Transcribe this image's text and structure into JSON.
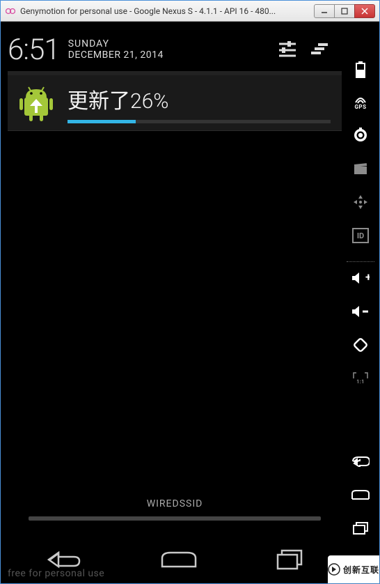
{
  "window": {
    "title": "Genymotion for personal use - Google Nexus S - 4.1.1 - API 16 - 480..."
  },
  "clock": {
    "time": "6:51",
    "day_of_week": "SUNDAY",
    "date": "DECEMBER 21, 2014"
  },
  "notification": {
    "title": "更新了26%",
    "progress_percent": 26
  },
  "shade": {
    "ssid": "WIREDSSID"
  },
  "watermark": "free for personal use",
  "corner_logo_text": "创新互联",
  "colors": {
    "holo_blue": "#33b5e5",
    "android_green": "#a4c739"
  },
  "side_tools": [
    {
      "id": "battery",
      "label": "battery-icon",
      "interactable": true,
      "dim": false
    },
    {
      "id": "gps",
      "label": "gps-icon",
      "interactable": true,
      "dim": false
    },
    {
      "id": "camera",
      "label": "camera-icon",
      "interactable": true,
      "dim": false
    },
    {
      "id": "remote",
      "label": "clapperboard-icon",
      "interactable": true,
      "dim": true
    },
    {
      "id": "dpad",
      "label": "dpad-icon",
      "interactable": true,
      "dim": true
    },
    {
      "id": "id",
      "label": "identifier-icon",
      "interactable": true,
      "dim": true
    },
    {
      "id": "vol-up",
      "label": "volume-up-icon",
      "interactable": true,
      "dim": false
    },
    {
      "id": "vol-down",
      "label": "volume-down-icon",
      "interactable": true,
      "dim": false
    },
    {
      "id": "rotate",
      "label": "rotate-icon",
      "interactable": true,
      "dim": false
    },
    {
      "id": "pixel",
      "label": "pixel-ratio-icon",
      "interactable": true,
      "dim": true
    },
    {
      "id": "back",
      "label": "back-icon",
      "interactable": true,
      "dim": false
    },
    {
      "id": "home",
      "label": "home-icon",
      "interactable": true,
      "dim": false
    },
    {
      "id": "recent",
      "label": "recent-apps-icon",
      "interactable": true,
      "dim": false
    },
    {
      "id": "power",
      "label": "power-icon",
      "interactable": true,
      "dim": false
    }
  ]
}
